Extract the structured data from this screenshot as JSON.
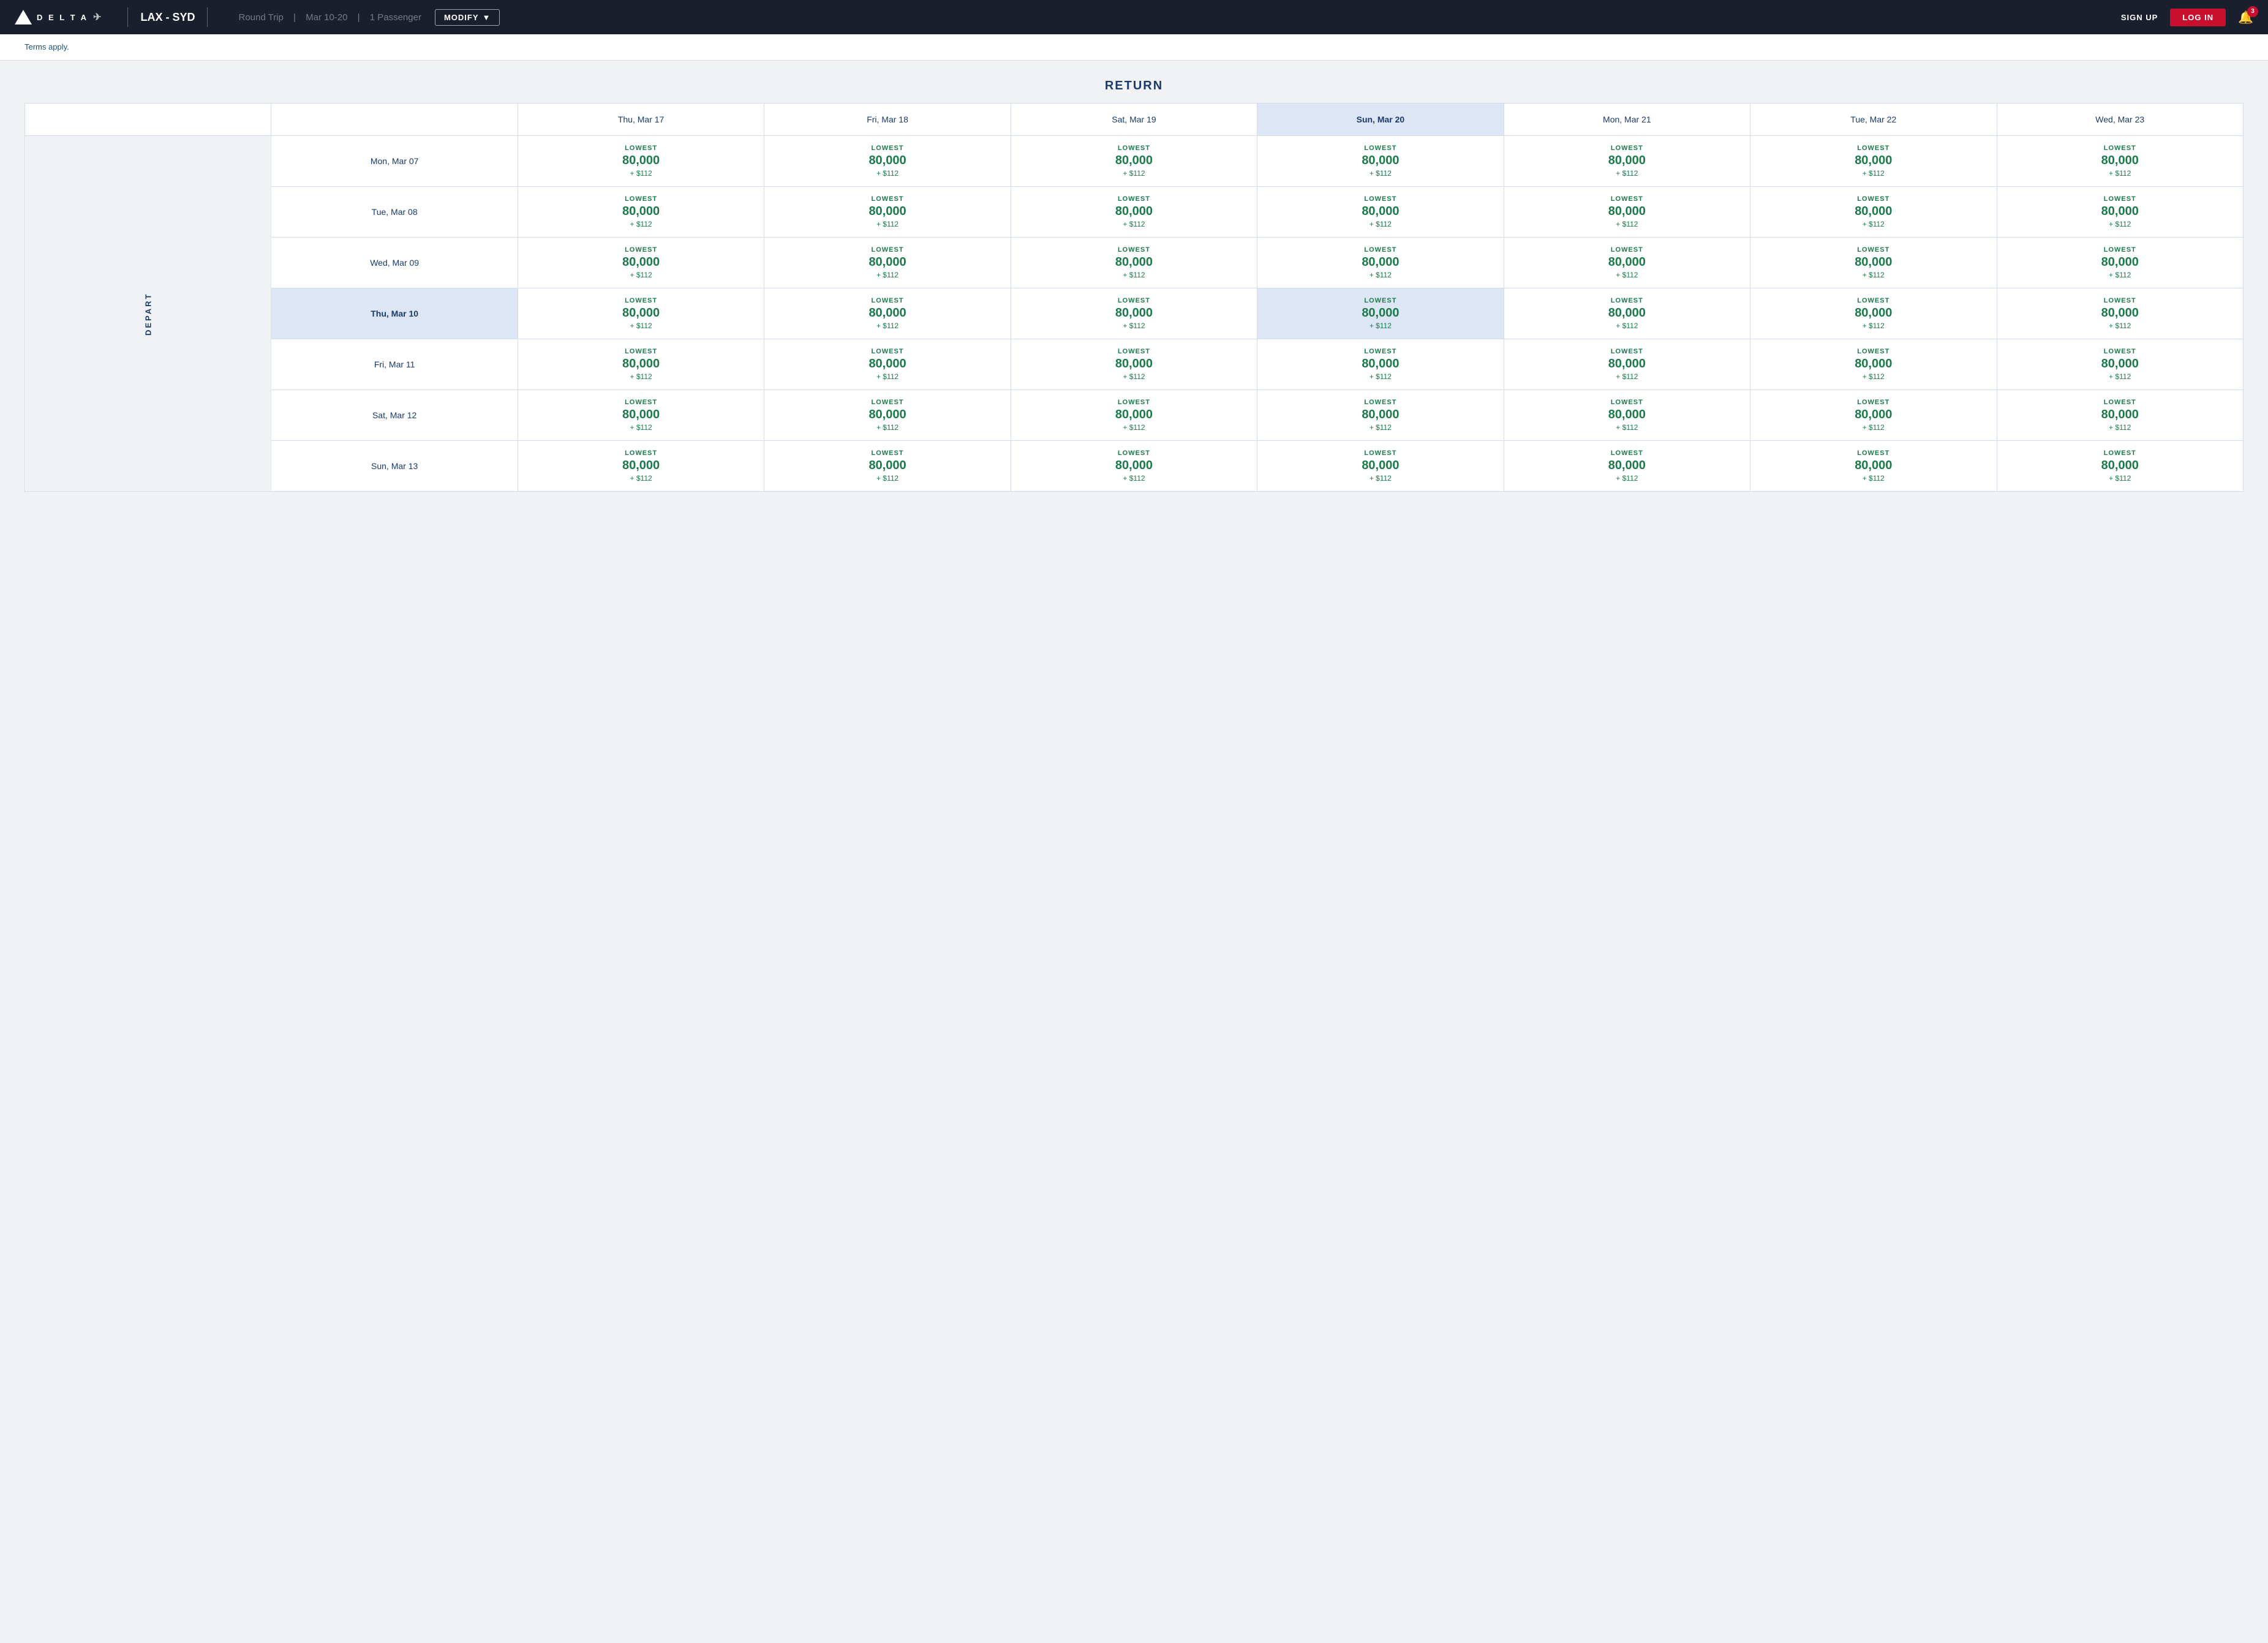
{
  "header": {
    "logo_text": "D E L T A",
    "route": "LAX - SYD",
    "trip_type": "Round Trip",
    "dates": "Mar 10-20",
    "passengers": "1 Passenger",
    "modify_label": "MODIFY",
    "signup_label": "SIGN UP",
    "login_label": "LOG IN",
    "notification_count": "3"
  },
  "terms": {
    "text": "Terms apply."
  },
  "grid": {
    "return_label": "RETURN",
    "depart_label": "DEPART",
    "col_headers": [
      {
        "label": "Thu, Mar 17",
        "selected": false
      },
      {
        "label": "Fri, Mar 18",
        "selected": false
      },
      {
        "label": "Sat, Mar 19",
        "selected": false
      },
      {
        "label": "Sun, Mar 20",
        "selected": true
      },
      {
        "label": "Mon, Mar 21",
        "selected": false
      },
      {
        "label": "Tue, Mar 22",
        "selected": false
      },
      {
        "label": "Wed, Mar 23",
        "selected": false
      }
    ],
    "rows": [
      {
        "date": "Mon, Mar 07",
        "selected": false,
        "cells": [
          {
            "lowest": true,
            "miles": "80,000",
            "cash": "+ $112",
            "selected": false
          },
          {
            "lowest": true,
            "miles": "80,000",
            "cash": "+ $112",
            "selected": false
          },
          {
            "lowest": true,
            "miles": "80,000",
            "cash": "+ $112",
            "selected": false
          },
          {
            "lowest": true,
            "miles": "80,000",
            "cash": "+ $112",
            "selected": false
          },
          {
            "lowest": true,
            "miles": "80,000",
            "cash": "+ $112",
            "selected": false
          },
          {
            "lowest": true,
            "miles": "80,000",
            "cash": "+ $112",
            "selected": false
          },
          {
            "lowest": true,
            "miles": "80,000",
            "cash": "+ $112",
            "selected": false
          }
        ]
      },
      {
        "date": "Tue, Mar 08",
        "selected": false,
        "cells": [
          {
            "lowest": true,
            "miles": "80,000",
            "cash": "+ $112",
            "selected": false
          },
          {
            "lowest": true,
            "miles": "80,000",
            "cash": "+ $112",
            "selected": false
          },
          {
            "lowest": true,
            "miles": "80,000",
            "cash": "+ $112",
            "selected": false
          },
          {
            "lowest": true,
            "miles": "80,000",
            "cash": "+ $112",
            "selected": false
          },
          {
            "lowest": true,
            "miles": "80,000",
            "cash": "+ $112",
            "selected": false
          },
          {
            "lowest": true,
            "miles": "80,000",
            "cash": "+ $112",
            "selected": false
          },
          {
            "lowest": true,
            "miles": "80,000",
            "cash": "+ $112",
            "selected": false
          }
        ]
      },
      {
        "date": "Wed, Mar 09",
        "selected": false,
        "cells": [
          {
            "lowest": true,
            "miles": "80,000",
            "cash": "+ $112",
            "selected": false
          },
          {
            "lowest": true,
            "miles": "80,000",
            "cash": "+ $112",
            "selected": false
          },
          {
            "lowest": true,
            "miles": "80,000",
            "cash": "+ $112",
            "selected": false
          },
          {
            "lowest": true,
            "miles": "80,000",
            "cash": "+ $112",
            "selected": false
          },
          {
            "lowest": true,
            "miles": "80,000",
            "cash": "+ $112",
            "selected": false
          },
          {
            "lowest": true,
            "miles": "80,000",
            "cash": "+ $112",
            "selected": false
          },
          {
            "lowest": true,
            "miles": "80,000",
            "cash": "+ $112",
            "selected": false
          }
        ]
      },
      {
        "date": "Thu, Mar 10",
        "selected": true,
        "cells": [
          {
            "lowest": true,
            "miles": "80,000",
            "cash": "+ $112",
            "selected": false
          },
          {
            "lowest": true,
            "miles": "80,000",
            "cash": "+ $112",
            "selected": false
          },
          {
            "lowest": true,
            "miles": "80,000",
            "cash": "+ $112",
            "selected": false
          },
          {
            "lowest": true,
            "miles": "80,000",
            "cash": "+ $112",
            "selected": true
          },
          {
            "lowest": true,
            "miles": "80,000",
            "cash": "+ $112",
            "selected": false
          },
          {
            "lowest": true,
            "miles": "80,000",
            "cash": "+ $112",
            "selected": false
          },
          {
            "lowest": true,
            "miles": "80,000",
            "cash": "+ $112",
            "selected": false
          }
        ]
      },
      {
        "date": "Fri, Mar 11",
        "selected": false,
        "cells": [
          {
            "lowest": true,
            "miles": "80,000",
            "cash": "+ $112",
            "selected": false
          },
          {
            "lowest": true,
            "miles": "80,000",
            "cash": "+ $112",
            "selected": false
          },
          {
            "lowest": true,
            "miles": "80,000",
            "cash": "+ $112",
            "selected": false
          },
          {
            "lowest": true,
            "miles": "80,000",
            "cash": "+ $112",
            "selected": false
          },
          {
            "lowest": true,
            "miles": "80,000",
            "cash": "+ $112",
            "selected": false
          },
          {
            "lowest": true,
            "miles": "80,000",
            "cash": "+ $112",
            "selected": false
          },
          {
            "lowest": true,
            "miles": "80,000",
            "cash": "+ $112",
            "selected": false
          }
        ]
      },
      {
        "date": "Sat, Mar 12",
        "selected": false,
        "cells": [
          {
            "lowest": true,
            "miles": "80,000",
            "cash": "+ $112",
            "selected": false
          },
          {
            "lowest": true,
            "miles": "80,000",
            "cash": "+ $112",
            "selected": false
          },
          {
            "lowest": true,
            "miles": "80,000",
            "cash": "+ $112",
            "selected": false
          },
          {
            "lowest": true,
            "miles": "80,000",
            "cash": "+ $112",
            "selected": false
          },
          {
            "lowest": true,
            "miles": "80,000",
            "cash": "+ $112",
            "selected": false
          },
          {
            "lowest": true,
            "miles": "80,000",
            "cash": "+ $112",
            "selected": false
          },
          {
            "lowest": true,
            "miles": "80,000",
            "cash": "+ $112",
            "selected": false
          }
        ]
      },
      {
        "date": "Sun, Mar 13",
        "selected": false,
        "cells": [
          {
            "lowest": true,
            "miles": "80,000",
            "cash": "+ $112",
            "selected": false
          },
          {
            "lowest": true,
            "miles": "80,000",
            "cash": "+ $112",
            "selected": false
          },
          {
            "lowest": true,
            "miles": "80,000",
            "cash": "+ $112",
            "selected": false
          },
          {
            "lowest": true,
            "miles": "80,000",
            "cash": "+ $112",
            "selected": false
          },
          {
            "lowest": true,
            "miles": "80,000",
            "cash": "+ $112",
            "selected": false
          },
          {
            "lowest": true,
            "miles": "80,000",
            "cash": "+ $112",
            "selected": false
          },
          {
            "lowest": true,
            "miles": "80,000",
            "cash": "+ $112",
            "selected": false
          }
        ]
      }
    ],
    "lowest_label": "LOWEST",
    "miles_suffix": ""
  }
}
